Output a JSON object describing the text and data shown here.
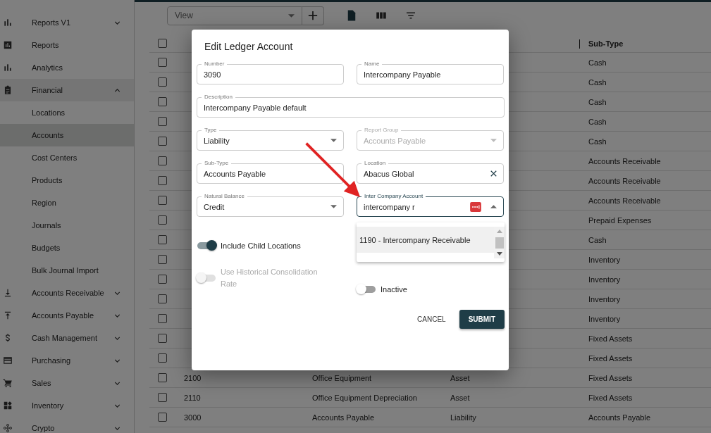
{
  "sidebar": {
    "items": [
      {
        "label": "Reports V1",
        "expanded": false
      },
      {
        "label": "Reports"
      },
      {
        "label": "Analytics"
      },
      {
        "label": "Financial",
        "expanded": true,
        "children": [
          {
            "label": "Locations",
            "selected": false
          },
          {
            "label": "Accounts",
            "selected": true
          },
          {
            "label": "Cost Centers",
            "selected": false
          },
          {
            "label": "Products",
            "selected": false
          },
          {
            "label": "Region",
            "selected": false
          },
          {
            "label": "Journals",
            "selected": false
          },
          {
            "label": "Budgets",
            "selected": false
          },
          {
            "label": "Bulk Journal Import",
            "selected": false
          }
        ]
      },
      {
        "label": "Accounts Receivable",
        "expanded": false
      },
      {
        "label": "Accounts Payable",
        "expanded": false
      },
      {
        "label": "Cash Management",
        "expanded": false
      },
      {
        "label": "Purchasing",
        "expanded": false
      },
      {
        "label": "Sales",
        "expanded": false
      },
      {
        "label": "Inventory",
        "expanded": false
      },
      {
        "label": "Crypto",
        "expanded": false
      }
    ]
  },
  "toolbar": {
    "view_select": {
      "placeholder": "View"
    }
  },
  "table": {
    "select_all": {
      "checked": false
    },
    "columns": [
      {
        "label": "Sub-Type"
      }
    ],
    "rows": [
      {
        "checked": false,
        "sub_type": "Cash"
      },
      {
        "checked": false,
        "sub_type": "Cash"
      },
      {
        "checked": false,
        "sub_type": "Cash"
      },
      {
        "checked": false,
        "sub_type": "Cash"
      },
      {
        "checked": false,
        "sub_type": "Cash"
      },
      {
        "checked": false,
        "sub_type": "Accounts Receivable"
      },
      {
        "checked": false,
        "sub_type": "Accounts Receivable"
      },
      {
        "checked": false,
        "sub_type": "Accounts Receivable"
      },
      {
        "checked": false,
        "sub_type": "Prepaid Expenses"
      },
      {
        "checked": false,
        "sub_type": "Cash"
      },
      {
        "checked": false,
        "sub_type": "Inventory"
      },
      {
        "checked": false,
        "sub_type": "Inventory"
      },
      {
        "checked": false,
        "sub_type": "Inventory"
      },
      {
        "checked": false,
        "sub_type": "Inventory"
      },
      {
        "checked": false,
        "sub_type": "Fixed Assets"
      },
      {
        "checked": false,
        "sub_type": "Fixed Assets"
      },
      {
        "checked": false,
        "number": "2100",
        "name": "Office Equipment",
        "type": "Asset",
        "sub_type": "Fixed Assets"
      },
      {
        "checked": false,
        "number": "2110",
        "name": "Office Equipment Depreciation",
        "type": "Asset",
        "sub_type": "Fixed Assets"
      },
      {
        "checked": false,
        "number": "3000",
        "name": "Accounts Payable",
        "type": "Liability",
        "sub_type": "Accounts Payable"
      }
    ]
  },
  "dialog": {
    "title": "Edit Ledger Account",
    "fields": [
      {
        "label": "Number",
        "value": "3090",
        "kind": "text",
        "disabled": false,
        "focused": false
      },
      {
        "label": "Name",
        "value": "Intercompany Payable",
        "kind": "text",
        "disabled": false,
        "focused": false
      },
      {
        "label": "Description",
        "value": "Intercompany Payable default",
        "kind": "text",
        "disabled": false,
        "focused": false
      },
      {
        "label": "Type",
        "value": "Liability",
        "kind": "select",
        "disabled": false,
        "focused": false
      },
      {
        "label": "Report Group",
        "value": "Accounts Payable",
        "kind": "select",
        "disabled": true,
        "focused": false
      },
      {
        "label": "Sub-Type",
        "value": "Accounts Payable",
        "kind": "text",
        "disabled": false,
        "focused": false
      },
      {
        "label": "Location",
        "value": "Abacus Global",
        "kind": "clearable",
        "disabled": false,
        "focused": false
      },
      {
        "label": "Natural Balance",
        "value": "Credit",
        "kind": "select",
        "disabled": false,
        "focused": false
      },
      {
        "label": "Inter Company Account",
        "value": "intercompany r",
        "kind": "autocomplete",
        "disabled": false,
        "focused": true
      }
    ],
    "options": [
      {
        "label": "1190 - Intercompany Receivable",
        "selected": true
      }
    ],
    "toggles": [
      {
        "label": "Include Child Locations",
        "on": true,
        "disabled": false
      },
      {
        "label": "Use Historical Consolidation Rate",
        "on": false,
        "disabled": true
      },
      {
        "label": "Inactive",
        "on": false,
        "disabled": false
      }
    ],
    "buttons": [
      {
        "label": "CANCEL",
        "kind": "text"
      },
      {
        "label": "SUBMIT",
        "kind": "primary"
      }
    ]
  }
}
